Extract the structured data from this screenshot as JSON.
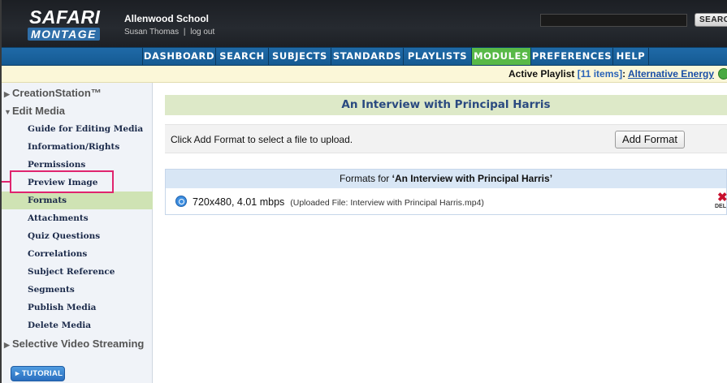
{
  "header": {
    "logo_top": "SAFARI",
    "logo_bottom": "MONTAGE",
    "school": "Allenwood School",
    "user": "Susan Thomas",
    "separator": "|",
    "logout": "log out",
    "search_button": "SEARCH"
  },
  "nav": {
    "items": [
      {
        "label": "DASHBOARD"
      },
      {
        "label": "SEARCH"
      },
      {
        "label": "SUBJECTS"
      },
      {
        "label": "STANDARDS"
      },
      {
        "label": "PLAYLISTS"
      },
      {
        "label": "MODULES",
        "active": true
      },
      {
        "label": "PREFERENCES"
      },
      {
        "label": "HELP"
      }
    ],
    "active_color": "#58b947",
    "bar_color": "#1f6aa8"
  },
  "playlist": {
    "prefix": "Active Playlist",
    "count": "[11 items]",
    "colon": ":",
    "name": "Alternative Energy"
  },
  "sidebar": {
    "creation_station": "CreationStation™",
    "edit_media": "Edit Media",
    "items": [
      {
        "label": "Guide for Editing Media"
      },
      {
        "label": "Information/Rights"
      },
      {
        "label": "Permissions"
      },
      {
        "label": "Preview Image"
      },
      {
        "label": "Formats",
        "active": true
      },
      {
        "label": "Attachments"
      },
      {
        "label": "Quiz Questions"
      },
      {
        "label": "Correlations"
      },
      {
        "label": "Subject Reference"
      },
      {
        "label": "Segments"
      },
      {
        "label": "Publish Media"
      },
      {
        "label": "Delete Media"
      }
    ],
    "selective": "Selective Video Streaming",
    "tutorial": "TUTORIAL",
    "highlight_color": "#e0246e"
  },
  "main": {
    "title": "An Interview with Principal Harris",
    "upload_text": "Click Add Format to select a file to upload.",
    "add_format": "Add Format",
    "formats_prefix": "Formats for",
    "formats_title": "‘An Interview with Principal Harris’",
    "format_spec": "720x480, 4.01 mbps",
    "format_file": "(Uploaded File: Interview with Principal Harris.mp4)",
    "delete_label": "DEL"
  }
}
